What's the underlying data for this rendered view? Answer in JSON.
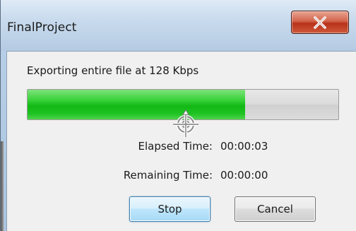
{
  "window": {
    "title": "FinalProject"
  },
  "dialog": {
    "status_text": "Exporting entire file at 128 Kbps",
    "progress_fraction": 0.7,
    "elapsed_label": "Elapsed Time:",
    "elapsed_value": "00:00:03",
    "remaining_label": "Remaining Time:",
    "remaining_value": "00:00:00"
  },
  "buttons": {
    "stop_label": "Stop",
    "cancel_label": "Cancel"
  },
  "icons": {
    "close": "close-x-icon",
    "cursor": "move-cursor-icon"
  },
  "colors": {
    "progress_green": "#12b814",
    "close_red": "#c7452a",
    "stop_focus_blue": "#3c7fb1"
  }
}
